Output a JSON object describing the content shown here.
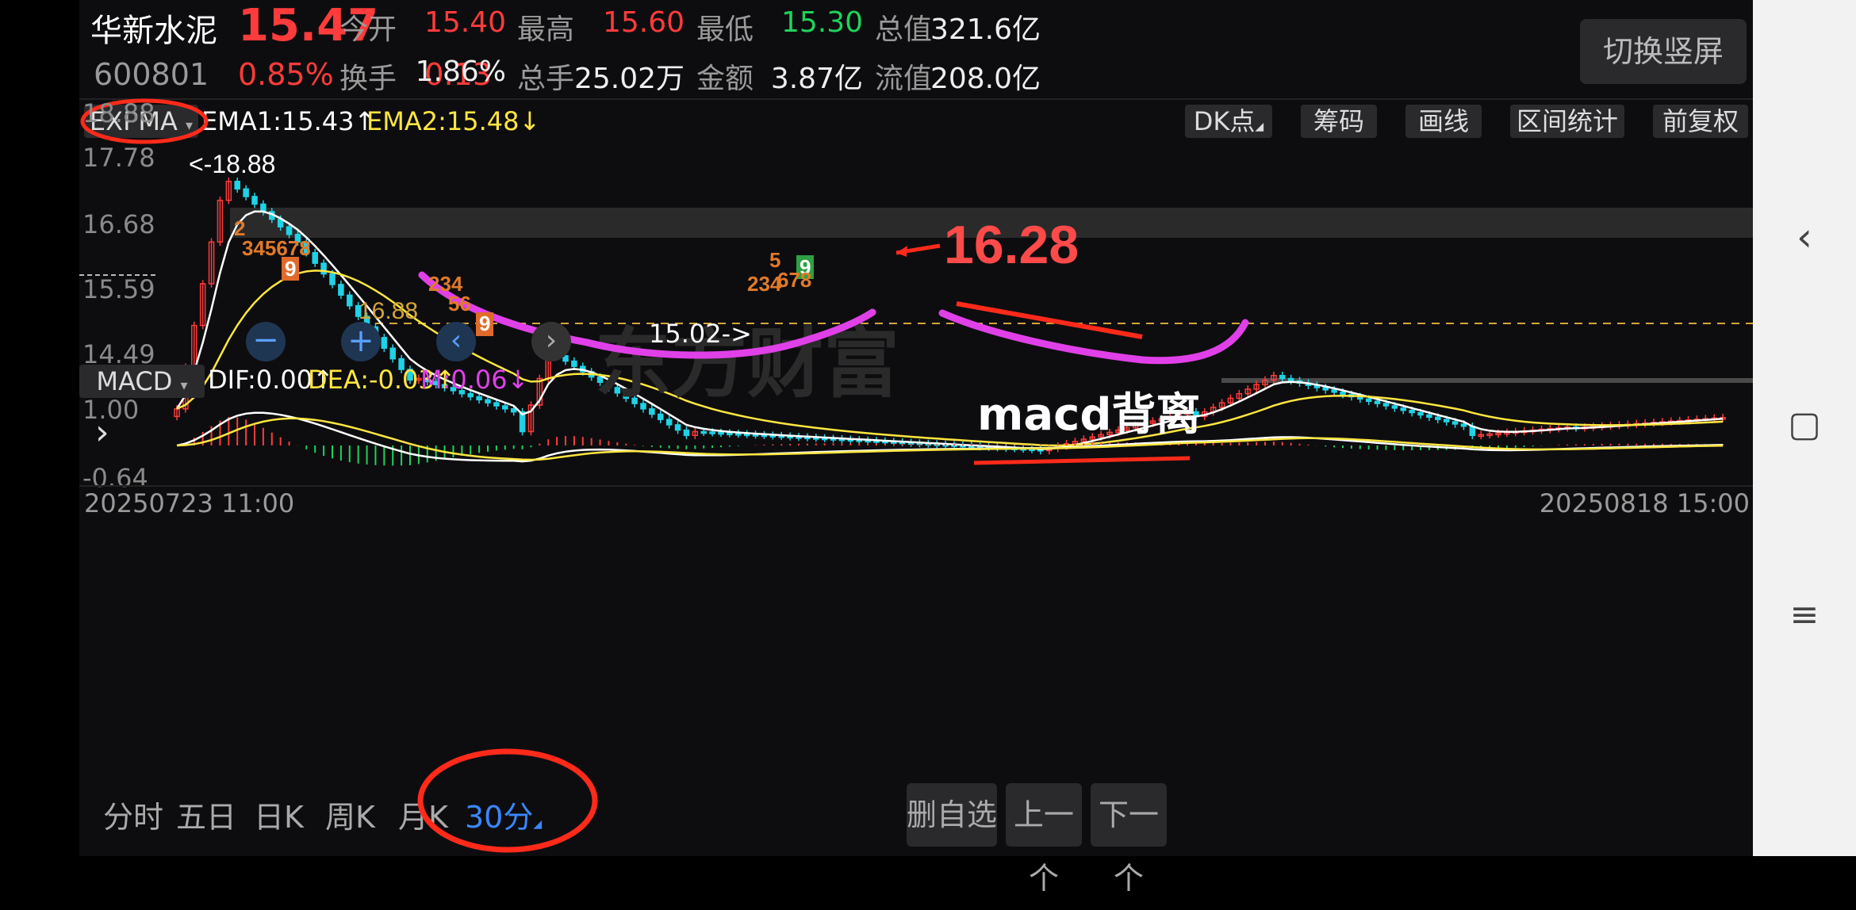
{
  "header": {
    "stock_name": "华新水泥",
    "price": "15.47",
    "code": "600801",
    "change_pct": "0.85%",
    "change_amt": "0.13",
    "quotes": [
      {
        "label": "今开",
        "value": "15.40",
        "color": "#ff3b3b"
      },
      {
        "label": "最高",
        "value": "15.60",
        "color": "#ff3b3b"
      },
      {
        "label": "最低",
        "value": "15.30",
        "color": "#1fd35a"
      },
      {
        "label": "总值",
        "value": "321.6亿",
        "color": "#eeeeee"
      },
      {
        "label": "换手",
        "value": "1.86%",
        "color": "#eeeeee"
      },
      {
        "label": "总手",
        "value": "25.02万",
        "color": "#eeeeee"
      },
      {
        "label": "金额",
        "value": "3.87亿",
        "color": "#eeeeee"
      },
      {
        "label": "流值",
        "value": "208.0亿",
        "color": "#eeeeee"
      }
    ],
    "switch_button": "切换竖屏"
  },
  "indicator_bar": {
    "main_indicator": "EXPMA",
    "ema1": "EMA1:15.43",
    "ema2": "EMA2:15.48",
    "buttons": [
      "DK点",
      "筹码",
      "画线",
      "区间统计",
      "前复权"
    ]
  },
  "price_axis": [
    "18.88",
    "17.78",
    "16.68",
    "15.59",
    "14.49"
  ],
  "annotations": {
    "high_marker": "<-18.88",
    "ref_line": "16.88",
    "low_marker": "15.02->",
    "handwritten_price": "16.28",
    "handwritten_note": "macd背离",
    "watermark": "东方财富"
  },
  "macd_bar": {
    "indicator": "MACD",
    "dif": "DIF:0.00",
    "dea": "DEA:-0.03",
    "m": "M:0.06",
    "axis_top": "1.00",
    "axis_bottom": "-0.64"
  },
  "time_axis": {
    "start": "20250723 11:00",
    "end": "20250818 15:00"
  },
  "period_tabs": [
    "分时",
    "五日",
    "日K",
    "周K",
    "月K",
    "30分"
  ],
  "active_tab": "30分",
  "bottom_buttons": [
    "删自选",
    "上一个",
    "下一个"
  ],
  "colors": {
    "up": "#ff3b3b",
    "down": "#1fd2e6",
    "ema1": "#ffffff",
    "ema2": "#ffe640",
    "annotation_pink": "#e040e8",
    "annotation_red": "#ff2a1a",
    "accent": "#3a87ff"
  },
  "icons": [
    "dropdown-triangle-icon",
    "arrow-up-icon",
    "arrow-down-icon",
    "zoom-out-icon",
    "zoom-in-icon",
    "chevron-left-icon",
    "chevron-right-icon",
    "expand-icon",
    "back-icon",
    "square-icon",
    "menu-icon"
  ]
}
